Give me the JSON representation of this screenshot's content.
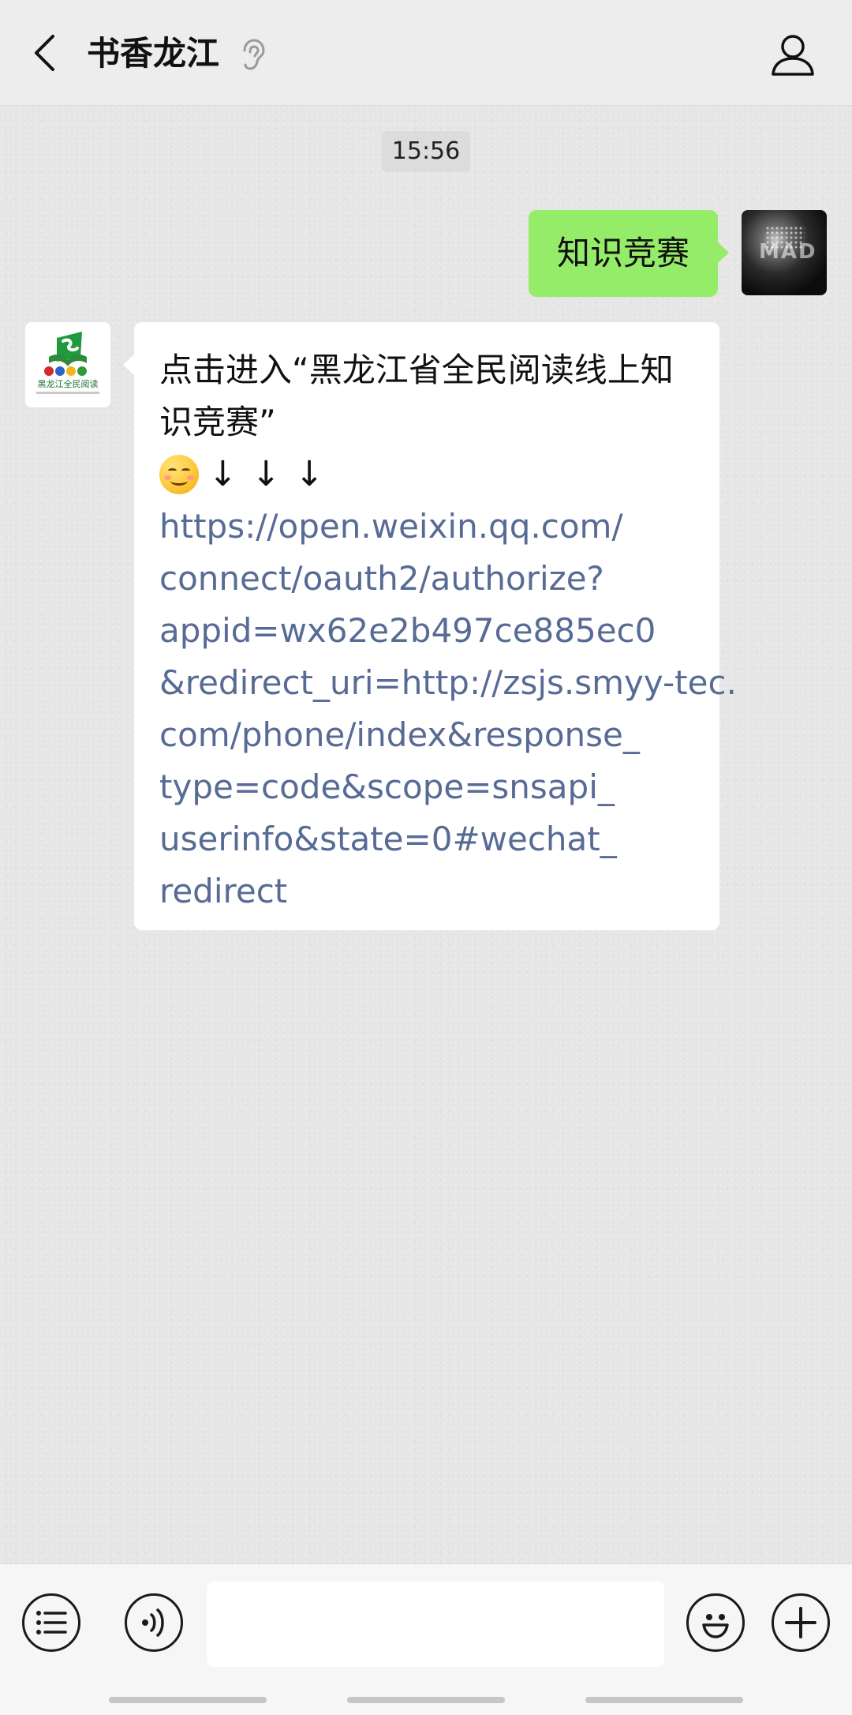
{
  "header": {
    "title": "书香龙江"
  },
  "chat": {
    "timestamp": "15:56",
    "outgoing_text": "知识竞赛",
    "my_avatar_mark": "MAD",
    "incoming": {
      "line1": "点击进入“黑龙江省全民阅读线上知",
      "line2": "识竞赛”",
      "arrows": "↓↓↓",
      "link_lines": [
        "https://open.weixin.qq.com/",
        "connect/oauth2/authorize?",
        "appid=wx62e2b497ce885ec0",
        "&redirect_uri=http://zsjs.smyy-tec.",
        "com/phone/index&response_",
        "type=code&scope=snsapi_",
        "userinfo&state=0#wechat_",
        "redirect"
      ]
    },
    "their_avatar_text": "黑龙江全民阅读"
  },
  "input": {
    "value": "",
    "placeholder": ""
  },
  "colors": {
    "link": "#576b95",
    "outgoing_bubble": "#95ec69",
    "incoming_bubble": "#ffffff"
  }
}
